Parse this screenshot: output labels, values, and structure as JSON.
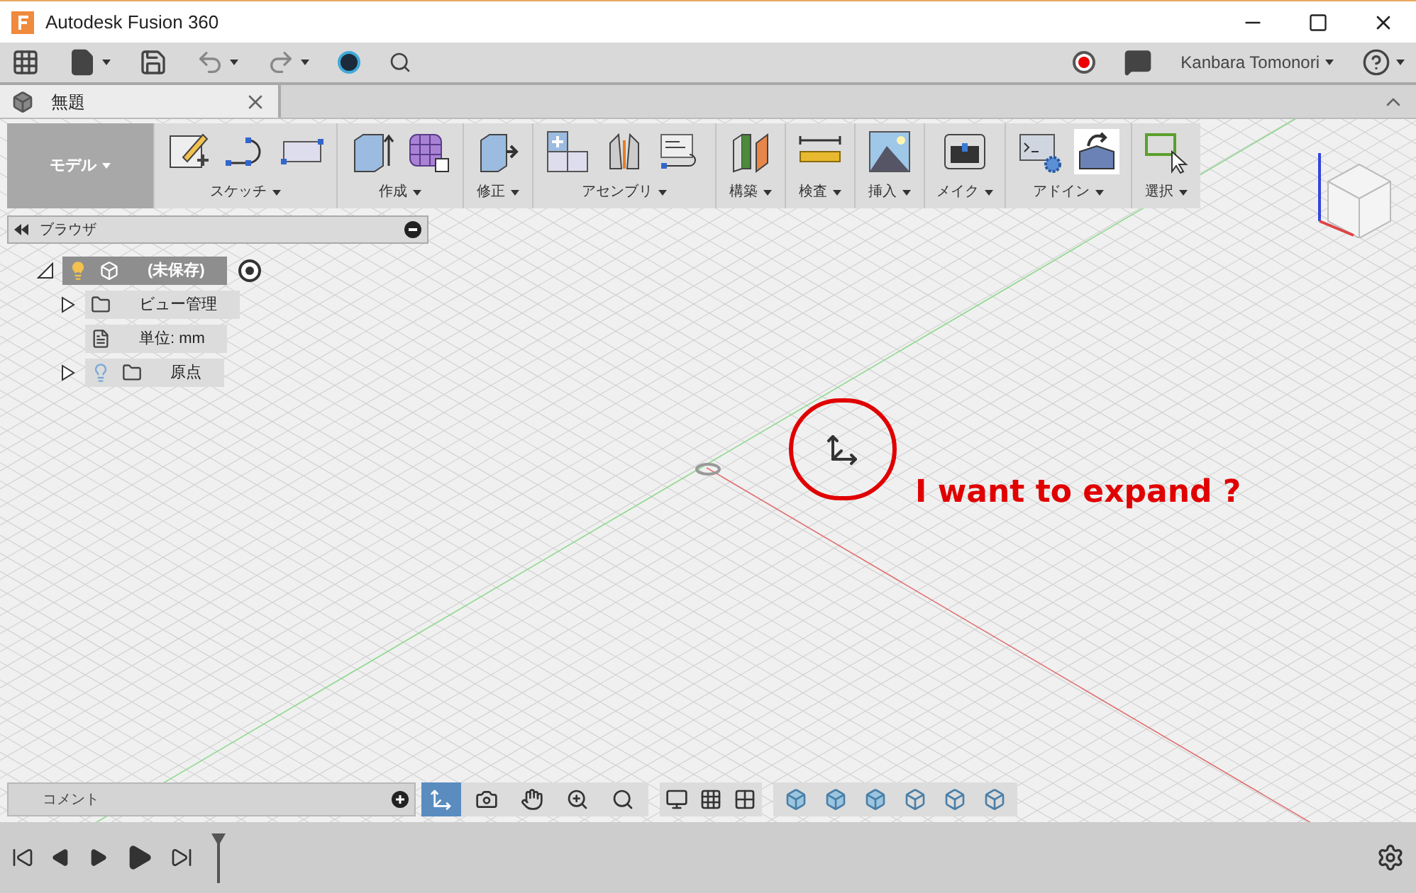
{
  "window": {
    "title": "Autodesk Fusion 360"
  },
  "account": {
    "user": "Kanbara Tomonori"
  },
  "document_tab": {
    "title": "無題"
  },
  "workspace": {
    "label": "モデル"
  },
  "toolbar_groups": [
    {
      "label": "スケッチ"
    },
    {
      "label": "作成"
    },
    {
      "label": "修正"
    },
    {
      "label": "アセンブリ"
    },
    {
      "label": "構築"
    },
    {
      "label": "検査"
    },
    {
      "label": "挿入"
    },
    {
      "label": "メイク"
    },
    {
      "label": "アドイン"
    },
    {
      "label": "選択"
    }
  ],
  "browser": {
    "title": "ブラウザ",
    "items": [
      {
        "label": "(未保存)",
        "expanded": true,
        "children": [
          {
            "label": "ビュー管理",
            "expanded": false
          },
          {
            "label": "単位: mm"
          },
          {
            "label": "原点",
            "expanded": false
          }
        ]
      }
    ]
  },
  "comment": {
    "placeholder": "コメント"
  },
  "nav_tools": [
    {
      "selected": true
    },
    {
      "selected": false
    },
    {
      "selected": false
    },
    {
      "selected": false
    },
    {
      "selected": false
    }
  ],
  "annotation": {
    "text": "I want to expand ?"
  }
}
